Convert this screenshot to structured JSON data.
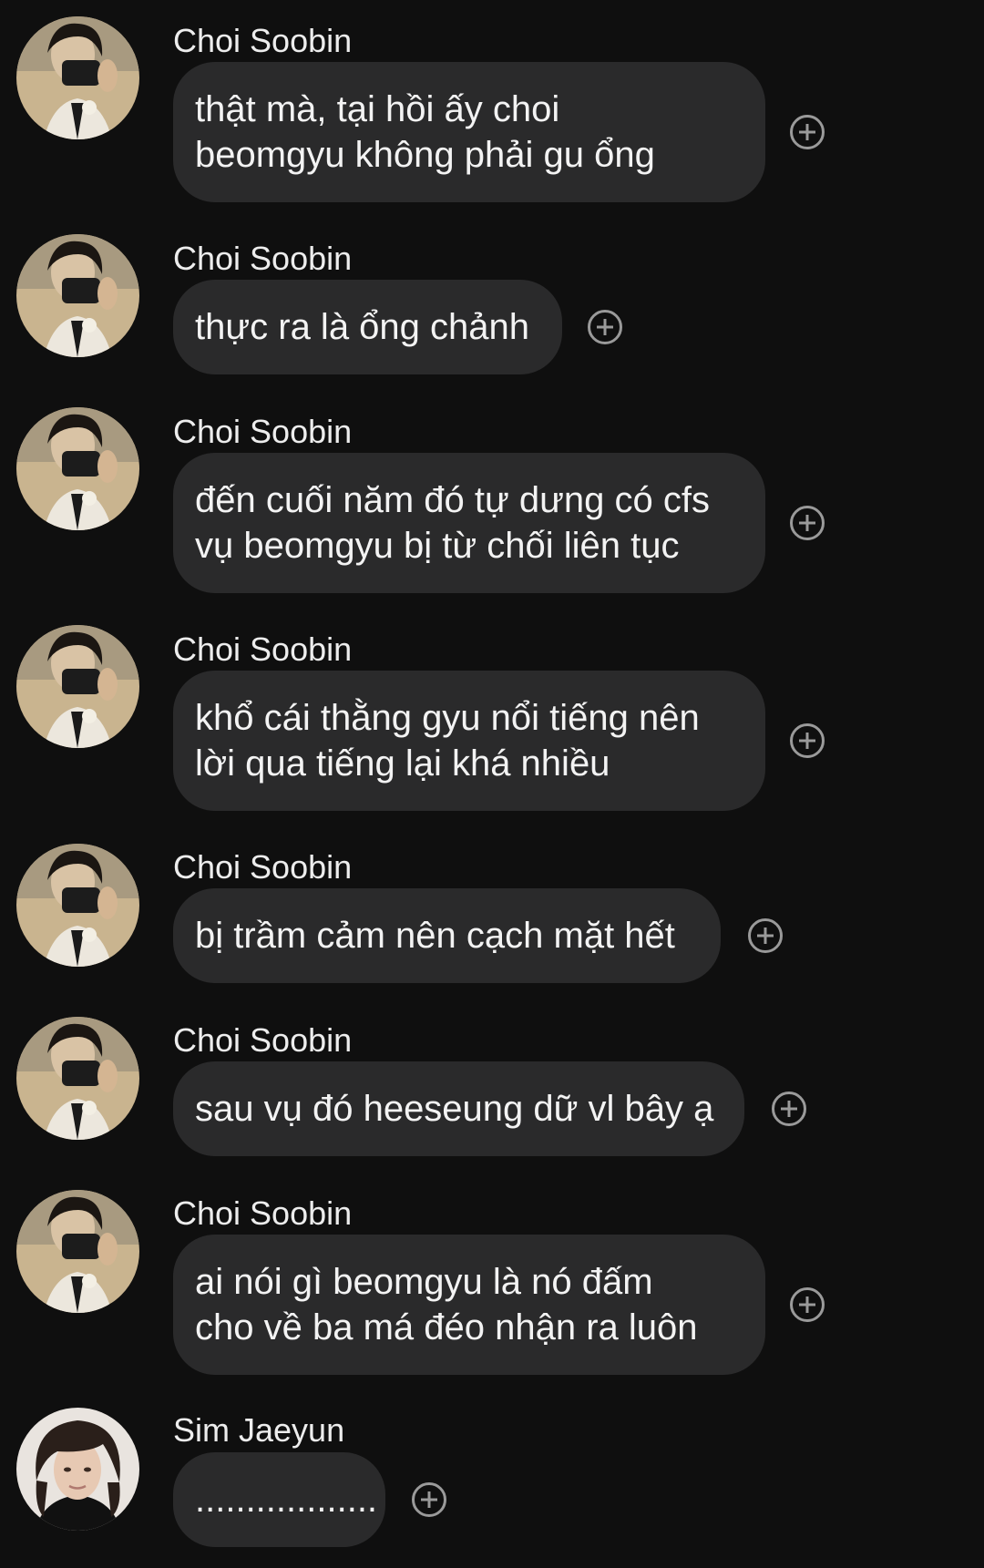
{
  "colors": {
    "background": "#0f0f0f",
    "bubble": "#2a2a2b",
    "text": "#f3f3f3",
    "react_icon": "#9a9a9a"
  },
  "messages": [
    {
      "sender": "Choi Soobin",
      "text": "thật mà, tại hồi ấy choi\nbeomgyu không phải gu ổng",
      "avatar": "avatar-soobin",
      "react_icon": "add-reaction-icon"
    },
    {
      "sender": "Choi Soobin",
      "text": "thực ra là ổng chảnh",
      "avatar": "avatar-soobin",
      "react_icon": "add-reaction-icon"
    },
    {
      "sender": "Choi Soobin",
      "text": "đến cuối năm đó tự dưng có cfs\nvụ beomgyu bị từ chối liên tục",
      "avatar": "avatar-soobin",
      "react_icon": "add-reaction-icon"
    },
    {
      "sender": "Choi Soobin",
      "text": "khổ cái thằng gyu nổi tiếng nên\nlời qua tiếng lại khá nhiều",
      "avatar": "avatar-soobin",
      "react_icon": "add-reaction-icon"
    },
    {
      "sender": "Choi Soobin",
      "text": "bị trầm cảm nên cạch mặt hết",
      "avatar": "avatar-soobin",
      "react_icon": "add-reaction-icon"
    },
    {
      "sender": "Choi Soobin",
      "text": "sau vụ đó heeseung dữ vl bây ạ",
      "avatar": "avatar-soobin",
      "react_icon": "add-reaction-icon"
    },
    {
      "sender": "Choi Soobin",
      "text": "ai nói gì beomgyu là nó đấm\ncho về ba má đéo nhận ra luôn",
      "avatar": "avatar-soobin",
      "react_icon": "add-reaction-icon"
    },
    {
      "sender": "Sim Jaeyun",
      "text": "..................",
      "avatar": "avatar-jaeyun",
      "react_icon": "add-reaction-icon"
    }
  ]
}
